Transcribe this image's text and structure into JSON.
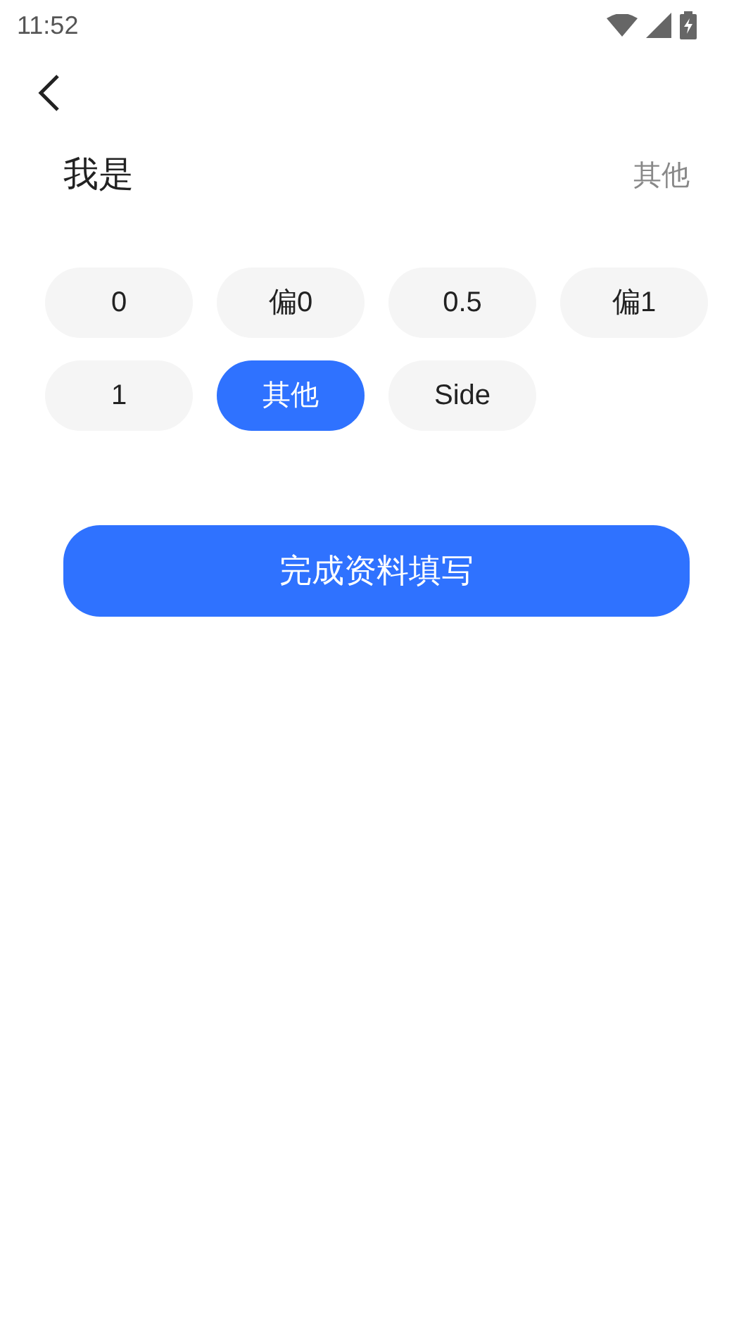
{
  "status_bar": {
    "time": "11:52"
  },
  "header": {
    "title": "我是",
    "value": "其他"
  },
  "options": [
    {
      "label": "0",
      "selected": false
    },
    {
      "label": "偏0",
      "selected": false
    },
    {
      "label": "0.5",
      "selected": false
    },
    {
      "label": "偏1",
      "selected": false
    },
    {
      "label": "1",
      "selected": false
    },
    {
      "label": "其他",
      "selected": true
    },
    {
      "label": "Side",
      "selected": false
    }
  ],
  "submit_button": {
    "label": "完成资料填写"
  }
}
